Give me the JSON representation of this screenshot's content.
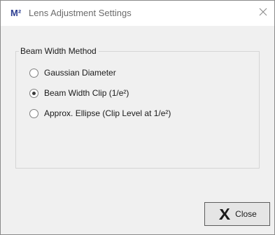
{
  "window": {
    "app_logo": "M²",
    "title": "Lens Adjustment Settings"
  },
  "group": {
    "title": "Beam Width Method",
    "options": [
      {
        "label": "Gaussian Diameter",
        "checked": false
      },
      {
        "label": "Beam Width Clip (1/e²)",
        "checked": true
      },
      {
        "label": "Approx. Ellipse (Clip Level at 1/e²)",
        "checked": false
      }
    ]
  },
  "buttons": {
    "close_label": "Close"
  },
  "icons": {
    "titlebar_close": "close-icon",
    "button_close": "x-icon"
  },
  "colors": {
    "logo": "#2c3e91",
    "title_text": "#6b6b6b",
    "dialog_background": "#f0f0f0"
  }
}
